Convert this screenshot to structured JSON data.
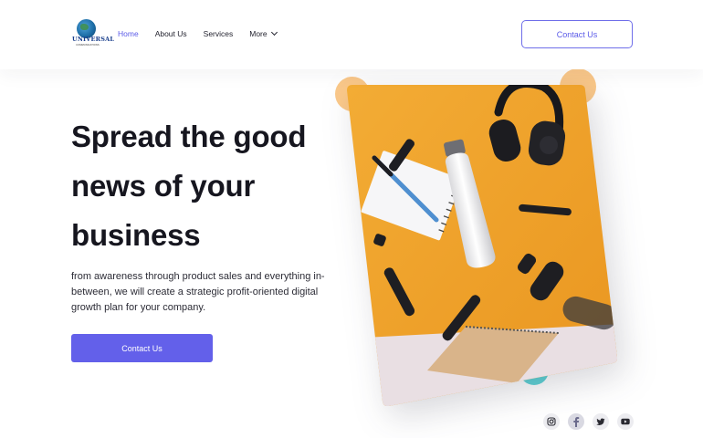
{
  "brand": {
    "logo_word": "UNIVERSAL",
    "logo_sub": "COMMUNICATIONS"
  },
  "nav": {
    "items": [
      {
        "label": "Home",
        "active": true
      },
      {
        "label": "About Us",
        "active": false
      },
      {
        "label": "Services",
        "active": false
      },
      {
        "label": "More",
        "active": false
      }
    ]
  },
  "header": {
    "cta_label": "Contact Us"
  },
  "hero": {
    "title": "Spread the good news of your business",
    "description": "from awareness through product sales and everything in-between, we will create a strategic profit-oriented digital growth plan for your company.",
    "cta_label": "Contact Us"
  },
  "social": {
    "icons": [
      "instagram-icon",
      "facebook-icon",
      "twitter-icon",
      "youtube-icon"
    ]
  },
  "colors": {
    "accent": "#6360ea",
    "nav_active": "#5b5be8",
    "decor_orange": "#fbc98a",
    "decor_teal": "#5fd3d6",
    "photo_orange": "#f2a72c"
  }
}
